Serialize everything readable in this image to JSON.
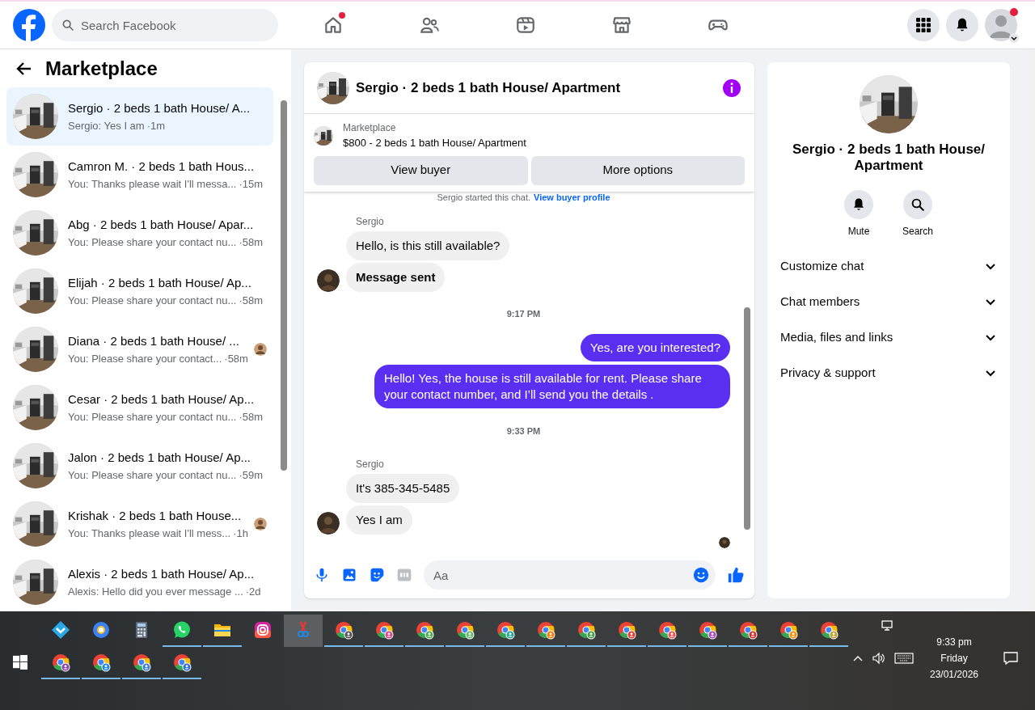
{
  "top_bar": {
    "search_placeholder": "Search Facebook",
    "nav": [
      {
        "kind": "home",
        "selected": false,
        "dot": true
      },
      {
        "kind": "friends",
        "selected": false,
        "dot": false
      },
      {
        "kind": "video",
        "selected": false,
        "dot": false
      },
      {
        "kind": "marketplace",
        "selected": false,
        "dot": false
      },
      {
        "kind": "gaming",
        "selected": false,
        "dot": false
      }
    ],
    "actions": [
      {
        "kind": "menu",
        "dot": false
      },
      {
        "kind": "notifications",
        "dot": false
      },
      {
        "kind": "profile",
        "dot": true
      }
    ]
  },
  "sidebar": {
    "title": "Marketplace",
    "conversations": [
      {
        "title": "Sergio · 2 beds 1 bath House/ A...",
        "preview": "Sergio: Yes I am",
        "time": "·1m",
        "selected": true,
        "seen": false
      },
      {
        "title": "Camron M. · 2 beds 1 bath Hous...",
        "preview": "You: Thanks please wait I'll messa...",
        "time": "·15m",
        "selected": false,
        "seen": false
      },
      {
        "title": "Abg · 2 beds 1 bath House/ Apar...",
        "preview": "You: Please share your contact nu...",
        "time": "·58m",
        "selected": false,
        "seen": false
      },
      {
        "title": "Elijah · 2 beds 1 bath House/ Ap...",
        "preview": "You: Please share your contact nu...",
        "time": "·58m",
        "selected": false,
        "seen": false
      },
      {
        "title": "Diana · 2 beds 1 bath House/ ...",
        "preview": "You: Please share your contact...",
        "time": "·58m",
        "selected": false,
        "seen": true
      },
      {
        "title": "Cesar · 2 beds 1 bath House/ Ap...",
        "preview": "You: Please share your contact nu...",
        "time": "·58m",
        "selected": false,
        "seen": false
      },
      {
        "title": "Jalon · 2 beds 1 bath House/ Ap...",
        "preview": "You: Please share your contact nu...",
        "time": "·59m",
        "selected": false,
        "seen": false
      },
      {
        "title": "Krishak · 2 beds 1 bath House...",
        "preview": "You: Thanks please wait I'll mess...",
        "time": "·1h",
        "selected": false,
        "seen": true
      },
      {
        "title": "Alexis · 2 beds 1 bath House/ Ap...",
        "preview": "Alexis: Hello did you ever message ...",
        "time": "·2d",
        "selected": false,
        "seen": false
      }
    ]
  },
  "chat": {
    "title": "Sergio · 2 beds 1 bath House/ Apartment",
    "listing": {
      "label": "Marketplace",
      "title": "$800 - 2 beds 1 bath House/ Apartment"
    },
    "buttons": [
      "View buyer",
      "More options"
    ],
    "notice": "Sergio started this chat.",
    "notice_link": "View buyer profile",
    "messages": [
      {
        "kind": "sender",
        "text": "Sergio"
      },
      {
        "kind": "incoming",
        "text": "Hello, is this still available?",
        "avatar": false,
        "bold": false
      },
      {
        "kind": "incoming",
        "text": "Message sent",
        "avatar": true,
        "bold": true
      },
      {
        "kind": "time",
        "text": "9:17 PM"
      },
      {
        "kind": "outgoing",
        "text": "Yes, are you interested?"
      },
      {
        "kind": "outgoing",
        "text": "Hello! Yes, the house is still available for rent. Please share your contact number, and I’ll send you the details ."
      },
      {
        "kind": "time",
        "text": "9:33 PM"
      },
      {
        "kind": "sender",
        "text": "Sergio"
      },
      {
        "kind": "incoming",
        "text": "It's 385-345-5485",
        "avatar": false,
        "bold": false
      },
      {
        "kind": "incoming",
        "text": "Yes I am",
        "avatar": true,
        "bold": false
      }
    ],
    "composer_placeholder": "Aa"
  },
  "details": {
    "title": "Sergio · 2 beds 1 bath House/ Apartment",
    "actions": [
      {
        "kind": "mute",
        "label": "Mute"
      },
      {
        "kind": "search",
        "label": "Search"
      }
    ],
    "sections": [
      {
        "label": "Customize chat",
        "expanded": false
      },
      {
        "label": "Chat members",
        "expanded": false
      },
      {
        "label": "Media, files and links",
        "expanded": false
      },
      {
        "label": "Privacy & support",
        "expanded": false
      }
    ]
  },
  "taskbar": {
    "apps": [
      {
        "kind": "store",
        "running": false,
        "selected": false
      },
      {
        "kind": "browser",
        "running": false,
        "selected": false
      },
      {
        "kind": "calculator",
        "running": false,
        "selected": false
      },
      {
        "kind": "whatsapp",
        "running": true,
        "selected": false
      },
      {
        "kind": "files",
        "running": true,
        "selected": false
      },
      {
        "kind": "instagram",
        "running": false,
        "selected": false
      },
      {
        "kind": "snipping",
        "running": false,
        "selected": true
      },
      {
        "kind": "chrome",
        "running": true,
        "selected": false,
        "color": "#555555"
      },
      {
        "kind": "chrome",
        "running": true,
        "selected": false,
        "color": "#d9468c"
      },
      {
        "kind": "chrome",
        "running": true,
        "selected": false,
        "color": "#4caf50"
      },
      {
        "kind": "chrome",
        "running": true,
        "selected": false,
        "color": "#66bb6a"
      },
      {
        "kind": "chrome",
        "running": true,
        "selected": false,
        "color": "#26a69a"
      },
      {
        "kind": "chrome",
        "running": true,
        "selected": false,
        "color": "#f57c00"
      },
      {
        "kind": "chrome",
        "running": true,
        "selected": false,
        "color": "#43a047"
      },
      {
        "kind": "chrome",
        "running": true,
        "selected": false,
        "color": "#e53935"
      },
      {
        "kind": "chrome",
        "running": true,
        "selected": false,
        "color": "#ef5350"
      },
      {
        "kind": "chrome",
        "running": true,
        "selected": false,
        "color": "#ab47bc"
      },
      {
        "kind": "chrome",
        "running": true,
        "selected": false,
        "color": "#d32f2f"
      },
      {
        "kind": "chrome",
        "running": true,
        "selected": false,
        "color": "#fb8c00"
      },
      {
        "kind": "chrome",
        "running": true,
        "selected": false,
        "color": "#c0a030"
      },
      {
        "kind": "chrome",
        "running": true,
        "selected": false,
        "color": "#8e44ad"
      },
      {
        "kind": "chrome",
        "running": true,
        "selected": false,
        "color": "#1e88e5"
      },
      {
        "kind": "chrome",
        "running": true,
        "selected": false,
        "color": "#3f7fd8"
      },
      {
        "kind": "chrome",
        "running": true,
        "selected": false,
        "color": "#2f6fd0"
      }
    ],
    "time": "9:33 pm",
    "day": "Friday",
    "date": "23/01/2026"
  }
}
